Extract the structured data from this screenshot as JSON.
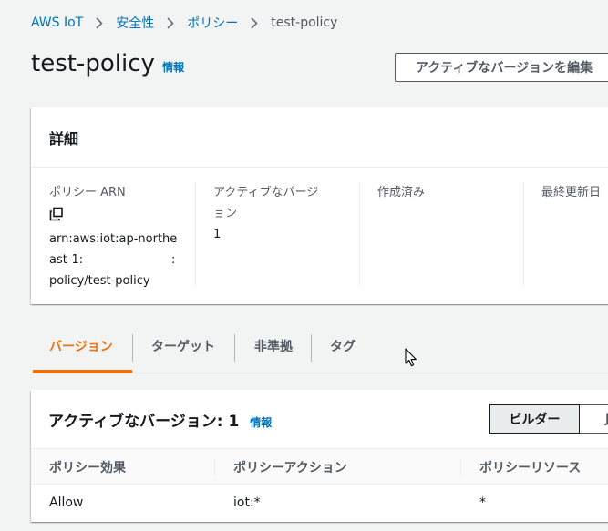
{
  "breadcrumb": {
    "items": [
      "AWS IoT",
      "安全性",
      "ポリシー"
    ],
    "current": "test-policy"
  },
  "page": {
    "title": "test-policy",
    "info_label": "情報",
    "edit_button_label": "アクティブなバージョンを編集"
  },
  "details": {
    "header": "詳細",
    "arn_label": "ポリシー ARN",
    "arn_line1": "arn:aws:iot:ap-northe",
    "arn_line2_left": "ast-1:",
    "arn_line2_right": ":",
    "arn_line3": "policy/test-policy",
    "active_version_label_line1": "アクティブなバージ",
    "active_version_label_line2": "ョン",
    "active_version_value": "1",
    "created_label": "作成済み",
    "updated_label": "最終更新日"
  },
  "tabs": [
    "バージョン",
    "ターゲット",
    "非準拠",
    "タグ"
  ],
  "versions": {
    "title": "アクティブなバージョン: 1",
    "info_label": "情報",
    "builder_label": "ビルダー",
    "json_label": "J",
    "columns": [
      "ポリシー効果",
      "ポリシーアクション",
      "ポリシーリソース"
    ],
    "rows": [
      {
        "effect": "Allow",
        "action": "iot:*",
        "resource": "*"
      }
    ]
  },
  "colors": {
    "link": "#0073bb",
    "tab_active": "#ec7211",
    "background": "#f2f3f3"
  },
  "icons": [
    "chevron-right-icon",
    "copy-icon",
    "mouse-cursor-icon"
  ]
}
